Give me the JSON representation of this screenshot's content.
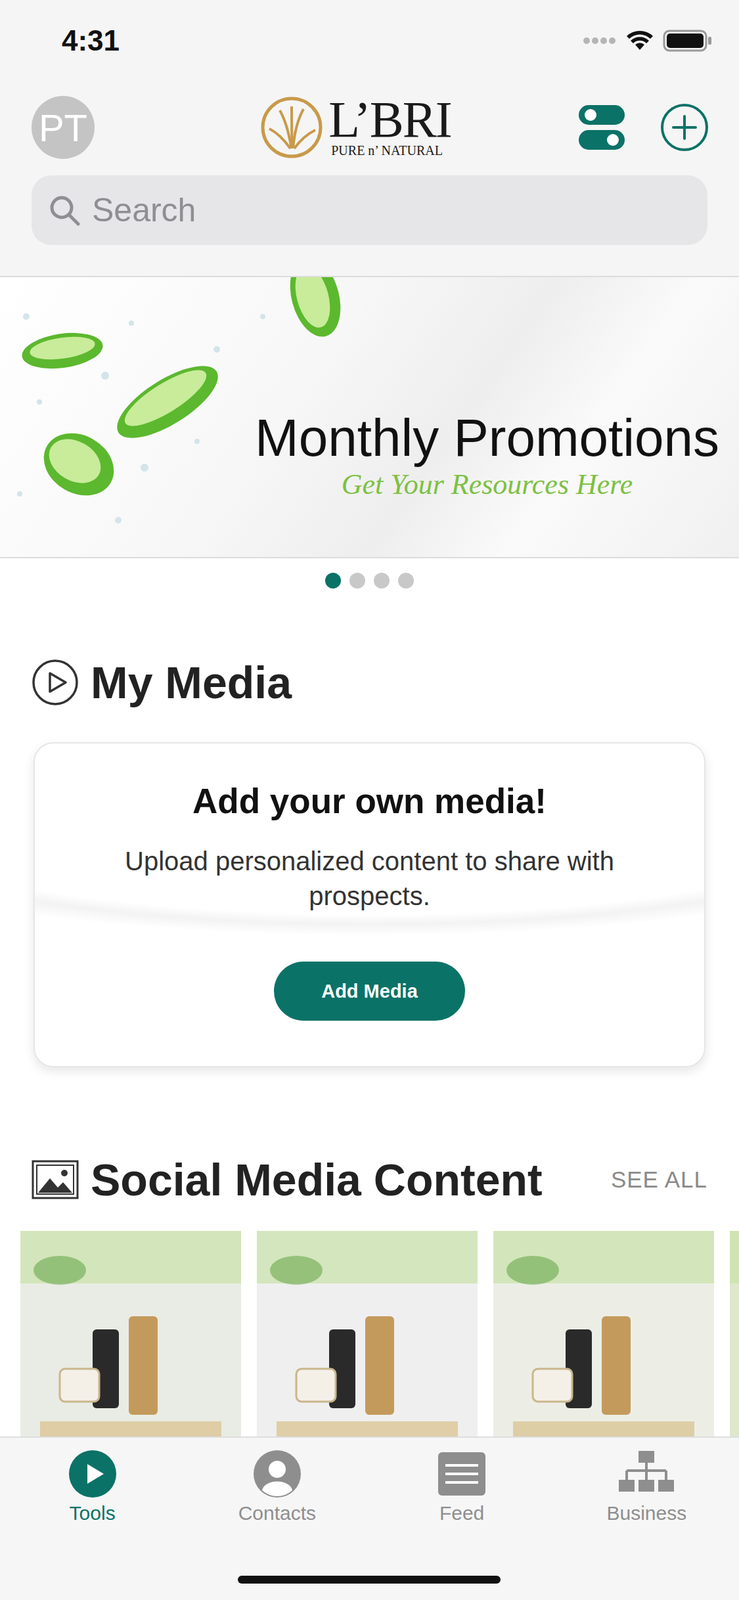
{
  "status_bar": {
    "time": "4:31"
  },
  "header": {
    "avatar": "PT",
    "logo": {
      "name": "L’BRI",
      "tagline": "PURE n’ NATURAL"
    }
  },
  "search": {
    "placeholder": "Search"
  },
  "banner": {
    "title": "Monthly Promotions",
    "subtitle": "Get Your Resources Here",
    "pages": [
      {
        "selected": true
      },
      {
        "selected": false
      },
      {
        "selected": false
      },
      {
        "selected": false
      }
    ]
  },
  "my_media": {
    "title": "My Media",
    "card": {
      "title": "Add your own media!",
      "text": "Upload personalized content to share with prospects.",
      "button": "Add Media"
    }
  },
  "social": {
    "title": "Social Media Content",
    "see_all": "SEE ALL",
    "items": [
      {
        "color": "#e9ece4"
      },
      {
        "color": "#efefef"
      },
      {
        "color": "#eceee6"
      },
      {
        "color": "#dfe8cc"
      }
    ]
  },
  "tabs": [
    {
      "label": "Tools",
      "selected": true
    },
    {
      "label": "Contacts",
      "selected": false
    },
    {
      "label": "Feed",
      "selected": false
    },
    {
      "label": "Business",
      "selected": false
    }
  ]
}
